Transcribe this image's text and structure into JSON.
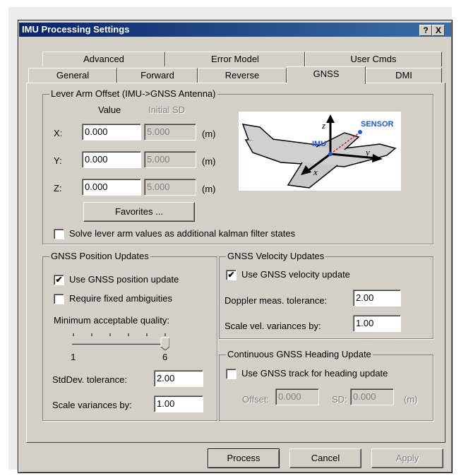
{
  "window": {
    "title": "IMU Processing Settings",
    "help_button": "?",
    "close_button": "X"
  },
  "tabs": {
    "row_back": [
      "Advanced",
      "Error Model",
      "User Cmds"
    ],
    "row_front": [
      "General",
      "Forward",
      "Reverse",
      "GNSS",
      "DMI"
    ],
    "active": "GNSS"
  },
  "lever_arm": {
    "legend": "Lever Arm Offset (IMU->GNSS Antenna)",
    "value_header": "Value",
    "sd_header": "Initial SD",
    "rows": [
      {
        "label": "X:",
        "value": "0.000",
        "sd": "5.000",
        "unit": "(m)"
      },
      {
        "label": "Y:",
        "value": "0.000",
        "sd": "5.000",
        "unit": "(m)"
      },
      {
        "label": "Z:",
        "value": "0.000",
        "sd": "5.000",
        "unit": "(m)"
      }
    ],
    "favorites_button": "Favorites ...",
    "solve_checkbox": {
      "label": "Solve lever arm values as additional kalman filter states",
      "checked": false
    },
    "diagram": {
      "sensor_label": "SENSOR",
      "imu_label": "IMU",
      "axis_z": "z",
      "axis_y": "y",
      "axis_x": "x"
    }
  },
  "position_updates": {
    "legend": "GNSS Position Updates",
    "use_update": {
      "label": "Use GNSS position update",
      "checked": true
    },
    "require_fixed": {
      "label": "Require fixed ambiguities",
      "checked": false
    },
    "min_quality_label": "Minimum acceptable quality:",
    "slider_min": "1",
    "slider_max": "6",
    "slider_value": 6,
    "stddev_label": "StdDev. tolerance:",
    "stddev_value": "2.00",
    "scale_label": "Scale variances by:",
    "scale_value": "1.00"
  },
  "velocity_updates": {
    "legend": "GNSS Velocity Updates",
    "use_update": {
      "label": "Use GNSS velocity update",
      "checked": true
    },
    "doppler_label": "Doppler meas. tolerance:",
    "doppler_value": "2.00",
    "scale_label": "Scale vel. variances by:",
    "scale_value": "1.00"
  },
  "heading_update": {
    "legend": "Continuous GNSS Heading Update",
    "use_track": {
      "label": "Use GNSS track for heading update",
      "checked": false
    },
    "offset_label": "Offset:",
    "offset_value": "0.000",
    "sd_label": "SD:",
    "sd_value": "0.000",
    "unit": "(m)"
  },
  "footer": {
    "process": "Process",
    "cancel": "Cancel",
    "apply": "Apply"
  },
  "colors": {
    "title_start": "#0a246a",
    "title_end": "#3a6ea5",
    "face": "#d4d0c8",
    "sensor_blue": "#1a56d6",
    "arrow_red": "#d42020"
  }
}
